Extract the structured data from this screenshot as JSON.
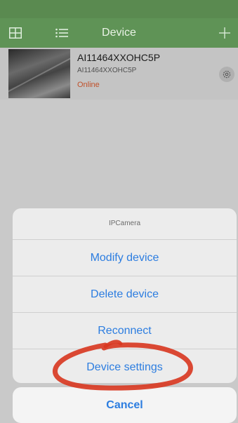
{
  "navbar": {
    "title": "Device",
    "left_icons": [
      "grid-view-icon",
      "list-view-icon"
    ],
    "right_icon": "plus-icon",
    "color": "#5f9356"
  },
  "device": {
    "name": "AI11464XXOHC5P",
    "id": "AI11464XXOHC5P",
    "status": "Online",
    "status_color": "#c0502a",
    "settings_icon": "gear-icon"
  },
  "action_sheet": {
    "title": "IPCamera",
    "items": [
      {
        "label": "Modify device"
      },
      {
        "label": "Delete device"
      },
      {
        "label": "Reconnect"
      },
      {
        "label": "Device settings"
      }
    ],
    "cancel_label": "Cancel",
    "accent": "#2c7de0"
  },
  "annotation": {
    "color": "#d8361f",
    "highlights": "Device settings"
  }
}
